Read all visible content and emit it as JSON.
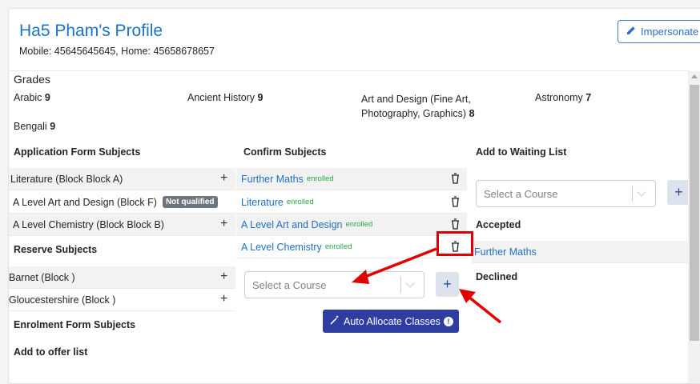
{
  "profile": {
    "title": "Ha5 Pham's Profile",
    "contact": "Mobile: 45645645645, Home: 45658678657",
    "impersonate_label": "Impersonate"
  },
  "grades": {
    "heading": "Grades",
    "items": [
      {
        "subject": "Arabic",
        "grade": "9"
      },
      {
        "subject": "Ancient History",
        "grade": "9"
      },
      {
        "subject": "Art and Design (Fine Art,",
        "subject_line2": "Photography, Graphics)",
        "grade": "8"
      },
      {
        "subject": "Astronomy",
        "grade": "7"
      },
      {
        "subject": "Bengali",
        "grade": "9"
      }
    ]
  },
  "application_form": {
    "heading": "Application Form Subjects",
    "items": [
      {
        "label": "Literature (Block Block A)",
        "badge": ""
      },
      {
        "label": "A Level Art and Design (Block F)",
        "badge": "Not qualified"
      },
      {
        "label": "A Level Chemistry (Block Block B)",
        "badge": ""
      }
    ]
  },
  "reserve": {
    "heading": "Reserve Subjects",
    "items": [
      {
        "label": "Barnet (Block )"
      },
      {
        "label": "Gloucestershire (Block )"
      }
    ]
  },
  "enrolment_heading": "Enrolment Form Subjects",
  "offer_heading": "Add to offer list",
  "confirm": {
    "heading": "Confirm Subjects",
    "items": [
      {
        "label": "Further Maths",
        "status": "enrolled"
      },
      {
        "label": "Literature",
        "status": "enrolled"
      },
      {
        "label": "A Level Art and Design",
        "status": "enrolled"
      },
      {
        "label": "A Level Chemistry",
        "status": "enrolled"
      }
    ],
    "select_placeholder": "Select a Course",
    "add_label": "+",
    "auto_allocate_label": "Auto Allocate Classes"
  },
  "waiting": {
    "heading": "Add to Waiting List",
    "select_placeholder": "Select a Course",
    "add_label": "+"
  },
  "accepted": {
    "heading": "Accepted",
    "items": [
      {
        "label": "Further Maths"
      }
    ]
  },
  "declined": {
    "heading": "Declined"
  },
  "colors": {
    "link": "#1f70c1",
    "enrolled": "#28a745",
    "auto_button": "#2e3ea0",
    "annotation": "#e00000"
  }
}
